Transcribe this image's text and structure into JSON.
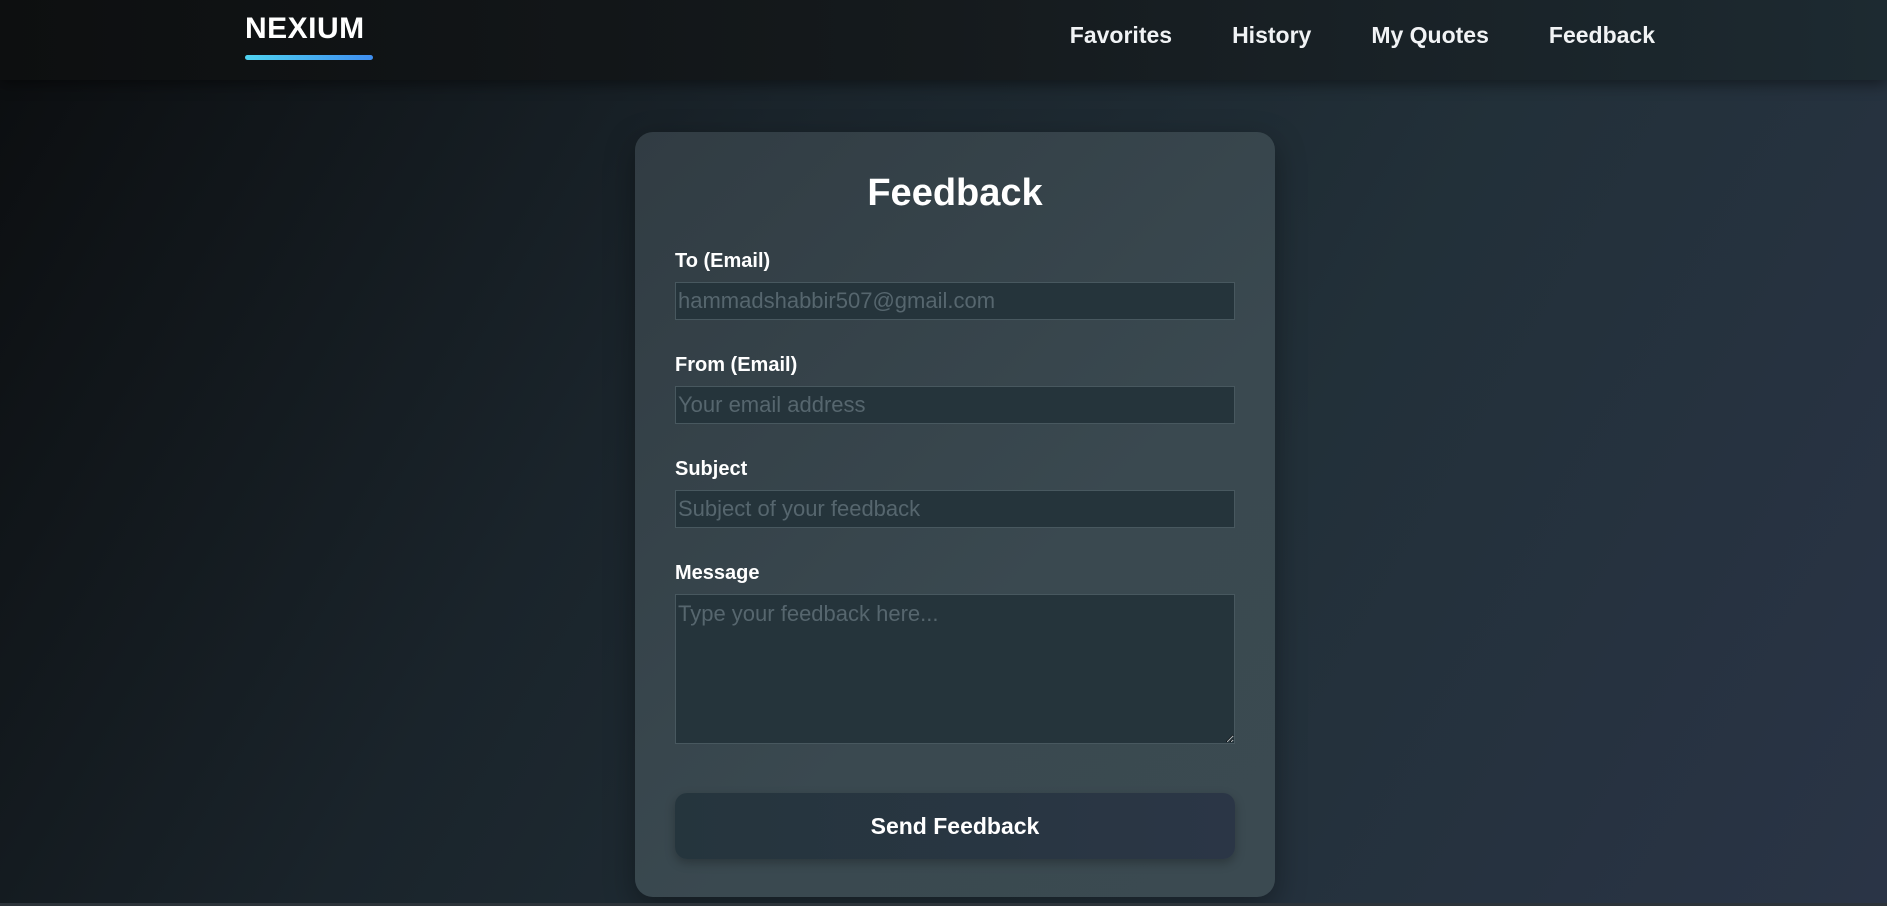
{
  "brand": {
    "name": "NEXIUM"
  },
  "nav": {
    "items": [
      {
        "label": "Favorites"
      },
      {
        "label": "History"
      },
      {
        "label": "My Quotes"
      },
      {
        "label": "Feedback"
      }
    ]
  },
  "form": {
    "title": "Feedback",
    "to": {
      "label": "To (Email)",
      "value": "",
      "placeholder": "hammadshabbir507@gmail.com"
    },
    "from": {
      "label": "From (Email)",
      "value": "",
      "placeholder": "Your email address"
    },
    "subject": {
      "label": "Subject",
      "value": "",
      "placeholder": "Subject of your feedback"
    },
    "message": {
      "label": "Message",
      "value": "",
      "placeholder": "Type your feedback here..."
    },
    "submit_label": "Send Feedback"
  },
  "colors": {
    "accent_gradient_start": "#4fd2f0",
    "accent_gradient_end": "#3f8ef0",
    "card_background": "#3a4950",
    "input_background": "#25343b"
  }
}
